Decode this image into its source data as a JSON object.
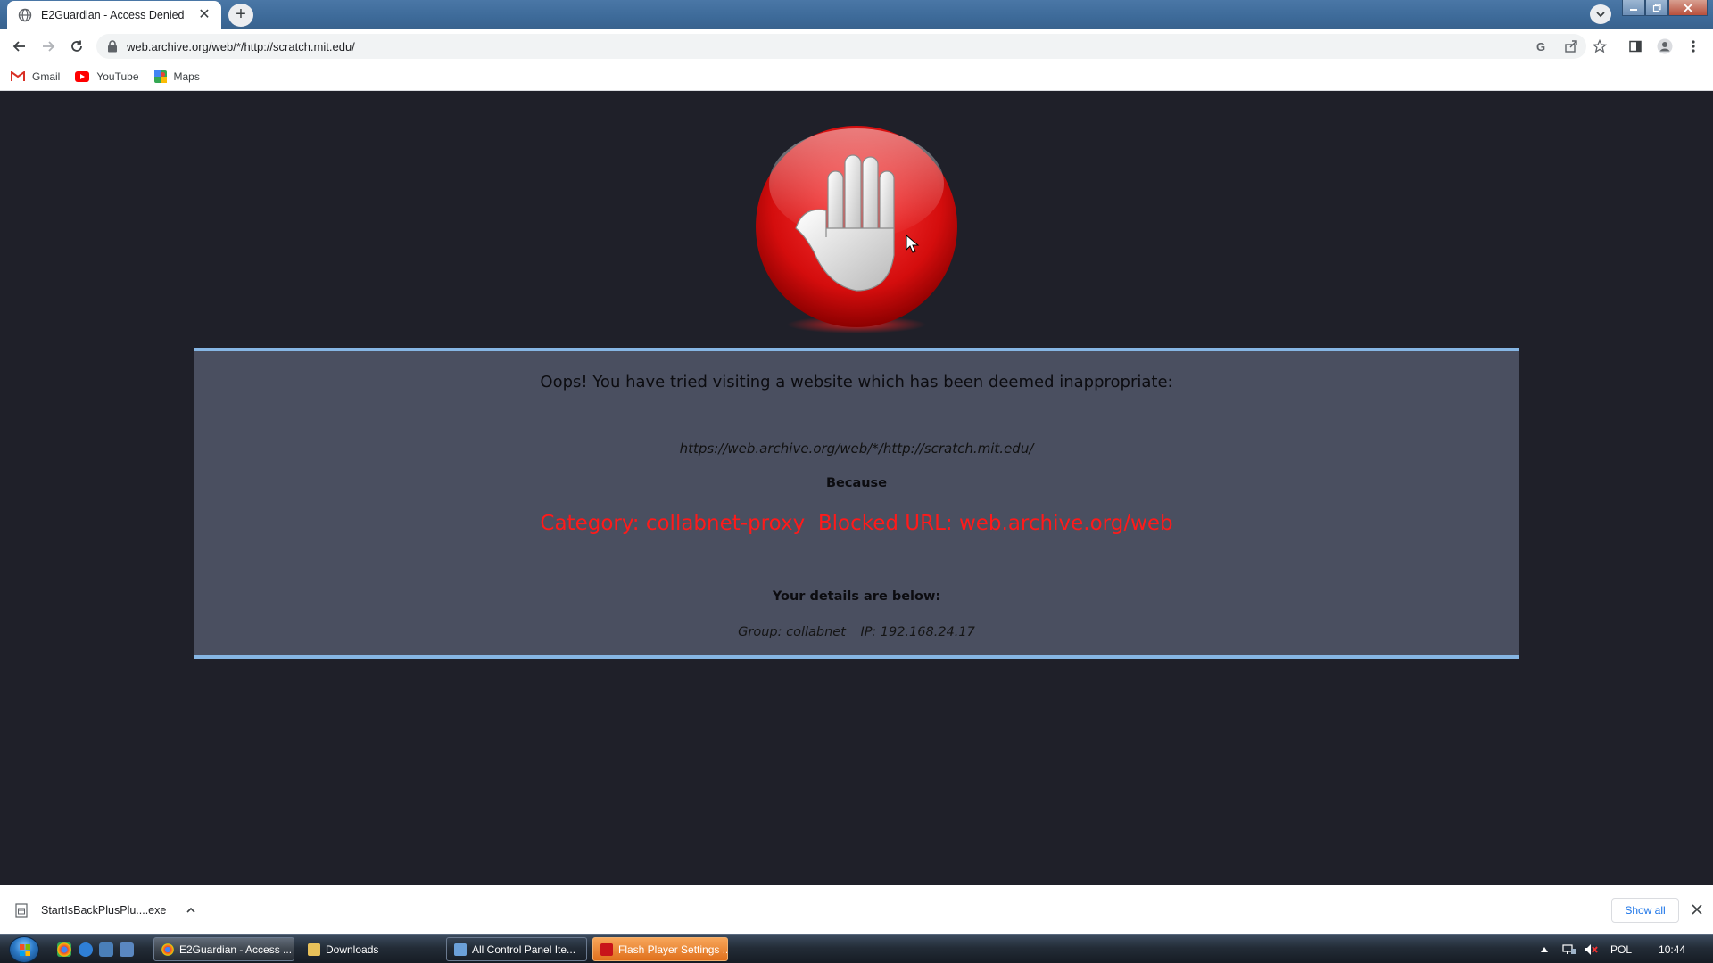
{
  "browser": {
    "tab_title": "E2Guardian - Access Denied",
    "tab_close": "✕",
    "new_tab": "+",
    "address": "web.archive.org/web/*/http://scratch.mit.edu/",
    "bookmarks": [
      {
        "label": "Gmail",
        "icon": "gmail-icon"
      },
      {
        "label": "YouTube",
        "icon": "youtube-icon"
      },
      {
        "label": "Maps",
        "icon": "maps-icon"
      }
    ]
  },
  "page": {
    "heading": "Oops! You have tried visiting a website which has been deemed inappropriate:",
    "blocked_url": "https://web.archive.org/web/*/http://scratch.mit.edu/",
    "because": "Because",
    "category_reason": "Category: collabnet-proxy  Blocked URL: web.archive.org/web",
    "details_heading": "Your details are below:",
    "group": "Group: collabnet",
    "ip": "IP: 192.168.24.17",
    "icon": "stop-hand-icon",
    "colors": {
      "background": "#1f2029",
      "panel": "#4a4f60",
      "accent_border": "#86b6e4",
      "reason_text": "#ff1a1a"
    }
  },
  "download_bar": {
    "file_name": "StartIsBackPlusPlu....exe",
    "show_all": "Show all"
  },
  "taskbar": {
    "buttons": [
      {
        "label": "E2Guardian - Access ...",
        "icon": "chrome-icon"
      },
      {
        "label": "Downloads",
        "icon": "folder-icon"
      },
      {
        "label": "All Control Panel Ite...",
        "icon": "control-panel-icon"
      },
      {
        "label": "Flash Player Settings ...",
        "icon": "flash-icon"
      }
    ],
    "language": "POL",
    "clock": "10:44"
  }
}
